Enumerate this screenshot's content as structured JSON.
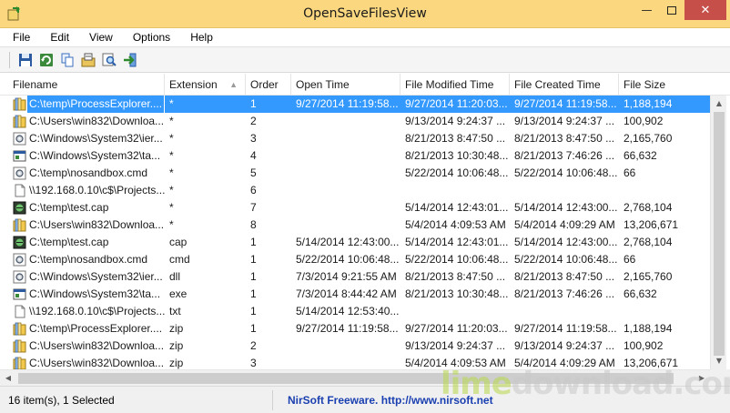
{
  "window": {
    "title": "OpenSaveFilesView"
  },
  "menu": [
    "File",
    "Edit",
    "View",
    "Options",
    "Help"
  ],
  "toolbar": [
    {
      "icon": "save-icon"
    },
    {
      "icon": "refresh-icon"
    },
    {
      "icon": "copy-icon"
    },
    {
      "icon": "properties-icon"
    },
    {
      "icon": "find-icon"
    },
    {
      "icon": "exit-icon"
    }
  ],
  "columns": [
    "Filename",
    "Extension",
    "Order",
    "Open Time",
    "File Modified Time",
    "File Created Time",
    "File Size"
  ],
  "rows": [
    {
      "icon": "folder-icon",
      "filename": "C:\\temp\\ProcessExplorer....",
      "extension": "*",
      "order": "1",
      "open_time": "9/27/2014 11:19:58...",
      "modified": "9/27/2014 11:20:03...",
      "created": "9/27/2014 11:19:58...",
      "size": "1,188,194",
      "selected": true
    },
    {
      "icon": "folder-icon",
      "filename": "C:\\Users\\win832\\Downloa...",
      "extension": "*",
      "order": "2",
      "open_time": "",
      "modified": "9/13/2014 9:24:37 ...",
      "created": "9/13/2014 9:24:37 ...",
      "size": "100,902"
    },
    {
      "icon": "gear-file-icon",
      "filename": "C:\\Windows\\System32\\ier...",
      "extension": "*",
      "order": "3",
      "open_time": "",
      "modified": "8/21/2013 8:47:50 ...",
      "created": "8/21/2013 8:47:50 ...",
      "size": "2,165,760"
    },
    {
      "icon": "app-file-icon",
      "filename": "C:\\Windows\\System32\\ta...",
      "extension": "*",
      "order": "4",
      "open_time": "",
      "modified": "8/21/2013 10:30:48...",
      "created": "8/21/2013 7:46:26 ...",
      "size": "66,632"
    },
    {
      "icon": "gear-file-icon",
      "filename": "C:\\temp\\nosandbox.cmd",
      "extension": "*",
      "order": "5",
      "open_time": "",
      "modified": "5/22/2014 10:06:48...",
      "created": "5/22/2014 10:06:48...",
      "size": "66"
    },
    {
      "icon": "blank-file-icon",
      "filename": "\\\\192.168.0.10\\c$\\Projects...",
      "extension": "*",
      "order": "6",
      "open_time": "",
      "modified": "",
      "created": "",
      "size": ""
    },
    {
      "icon": "capture-file-icon",
      "filename": "C:\\temp\\test.cap",
      "extension": "*",
      "order": "7",
      "open_time": "",
      "modified": "5/14/2014 12:43:01...",
      "created": "5/14/2014 12:43:00...",
      "size": "2,768,104"
    },
    {
      "icon": "folder-icon",
      "filename": "C:\\Users\\win832\\Downloa...",
      "extension": "*",
      "order": "8",
      "open_time": "",
      "modified": "5/4/2014 4:09:53 AM",
      "created": "5/4/2014 4:09:29 AM",
      "size": "13,206,671"
    },
    {
      "icon": "capture-file-icon",
      "filename": "C:\\temp\\test.cap",
      "extension": "cap",
      "order": "1",
      "open_time": "5/14/2014 12:43:00...",
      "modified": "5/14/2014 12:43:01...",
      "created": "5/14/2014 12:43:00...",
      "size": "2,768,104"
    },
    {
      "icon": "gear-file-icon",
      "filename": "C:\\temp\\nosandbox.cmd",
      "extension": "cmd",
      "order": "1",
      "open_time": "5/22/2014 10:06:48...",
      "modified": "5/22/2014 10:06:48...",
      "created": "5/22/2014 10:06:48...",
      "size": "66"
    },
    {
      "icon": "gear-file-icon",
      "filename": "C:\\Windows\\System32\\ier...",
      "extension": "dll",
      "order": "1",
      "open_time": "7/3/2014 9:21:55 AM",
      "modified": "8/21/2013 8:47:50 ...",
      "created": "8/21/2013 8:47:50 ...",
      "size": "2,165,760"
    },
    {
      "icon": "app-file-icon",
      "filename": "C:\\Windows\\System32\\ta...",
      "extension": "exe",
      "order": "1",
      "open_time": "7/3/2014 8:44:42 AM",
      "modified": "8/21/2013 10:30:48...",
      "created": "8/21/2013 7:46:26 ...",
      "size": "66,632"
    },
    {
      "icon": "blank-file-icon",
      "filename": "\\\\192.168.0.10\\c$\\Projects...",
      "extension": "txt",
      "order": "1",
      "open_time": "5/14/2014 12:53:40...",
      "modified": "",
      "created": "",
      "size": ""
    },
    {
      "icon": "folder-icon",
      "filename": "C:\\temp\\ProcessExplorer....",
      "extension": "zip",
      "order": "1",
      "open_time": "9/27/2014 11:19:58...",
      "modified": "9/27/2014 11:20:03...",
      "created": "9/27/2014 11:19:58...",
      "size": "1,188,194"
    },
    {
      "icon": "folder-icon",
      "filename": "C:\\Users\\win832\\Downloa...",
      "extension": "zip",
      "order": "2",
      "open_time": "",
      "modified": "9/13/2014 9:24:37 ...",
      "created": "9/13/2014 9:24:37 ...",
      "size": "100,902"
    },
    {
      "icon": "folder-icon",
      "filename": "C:\\Users\\win832\\Downloa...",
      "extension": "zip",
      "order": "3",
      "open_time": "",
      "modified": "5/4/2014 4:09:53 AM",
      "created": "5/4/2014 4:09:29 AM",
      "size": "13,206,671"
    }
  ],
  "status": {
    "count": "16 item(s), 1 Selected",
    "link": "NirSoft Freeware.  http://www.nirsoft.net"
  },
  "watermark": {
    "part1": "lime",
    "part2": "download.com"
  }
}
